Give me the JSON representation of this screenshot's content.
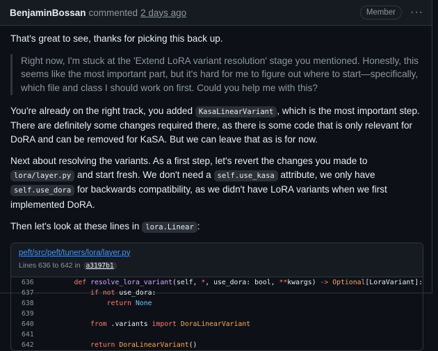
{
  "header": {
    "author": "BenjaminBossan",
    "action": "commented",
    "time": "2 days ago",
    "badge": "Member",
    "menu_glyph": "···"
  },
  "body": {
    "p1": "That's great to see, thanks for picking this back up.",
    "quote": "Right now, I'm stuck at the 'Extend LoRA variant resolution' stage you mentioned. Honestly, this seems like the most important part, but it's hard for me to figure out where to start—specifically, which file and class I should work on first. Could you help me with this?",
    "p2_a": "You're already on the right track, you added ",
    "p2_code": "KasaLinearVariant",
    "p2_b": ", which is the most important step. There are definitely some changes required there, as there is some code that is only relevant for DoRA and can be removed for KaSA. But we can leave that as is for now.",
    "p3_a": "Next about resolving the variants. As a first step, let's revert the changes you made to ",
    "p3_code1": "lora/layer.py",
    "p3_b": " and start fresh. We don't need a ",
    "p3_code2": "self.use_kasa",
    "p3_c": " attribute, we only have ",
    "p3_code3": "self.use_dora",
    "p3_d": " for backwards compatibility, as we didn't have LoRA variants when we first implemented DoRA.",
    "p4_a": "Then let's look at these lines in ",
    "p4_code": "lora.Linear",
    "p4_b": ":"
  },
  "permalink": {
    "path": "peft/src/peft/tuners/lora/layer.py",
    "lines": "Lines 636 to 642 in",
    "sha": "a3197b1"
  },
  "code_lines": [
    {
      "num": "636",
      "text": "    def resolve_lora_variant(self, *, use_dora: bool, **kwargs) -> Optional[LoraVariant]:"
    },
    {
      "num": "637",
      "text": "        if not use_dora:"
    },
    {
      "num": "638",
      "text": "            return None"
    },
    {
      "num": "639",
      "text": ""
    },
    {
      "num": "640",
      "text": "        from .variants import DoraLinearVariant"
    },
    {
      "num": "641",
      "text": ""
    },
    {
      "num": "642",
      "text": "        return DoraLinearVariant()"
    }
  ]
}
